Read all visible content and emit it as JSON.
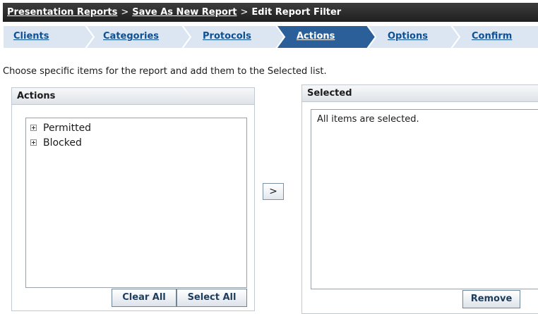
{
  "breadcrumb": {
    "items": [
      {
        "label": "Presentation Reports",
        "link": true
      },
      {
        "label": "Save As New Report",
        "link": true
      },
      {
        "label": "Edit Report Filter",
        "link": false
      }
    ],
    "separator": ">"
  },
  "steps": {
    "items": [
      {
        "label": "Clients",
        "active": false
      },
      {
        "label": "Categories",
        "active": false
      },
      {
        "label": "Protocols",
        "active": false
      },
      {
        "label": "Actions",
        "active": true
      },
      {
        "label": "Options",
        "active": false
      },
      {
        "label": "Confirm",
        "active": false
      }
    ],
    "colors": {
      "inactive_bg": "#dbe6f2",
      "active_bg": "#2a5f99",
      "inactive_text": "#0f4f93",
      "active_text": "#ffffff"
    }
  },
  "instruction": "Choose specific items for the report and add them to the Selected list.",
  "actions_panel": {
    "title": "Actions",
    "tree": [
      {
        "label": "Permitted",
        "icon": "plus-expander-icon"
      },
      {
        "label": "Blocked",
        "icon": "plus-expander-icon"
      }
    ],
    "clear_all_label": "Clear All",
    "select_all_label": "Select All"
  },
  "move_button_label": ">",
  "selected_panel": {
    "title": "Selected",
    "message": "All items are selected.",
    "remove_label": "Remove"
  }
}
